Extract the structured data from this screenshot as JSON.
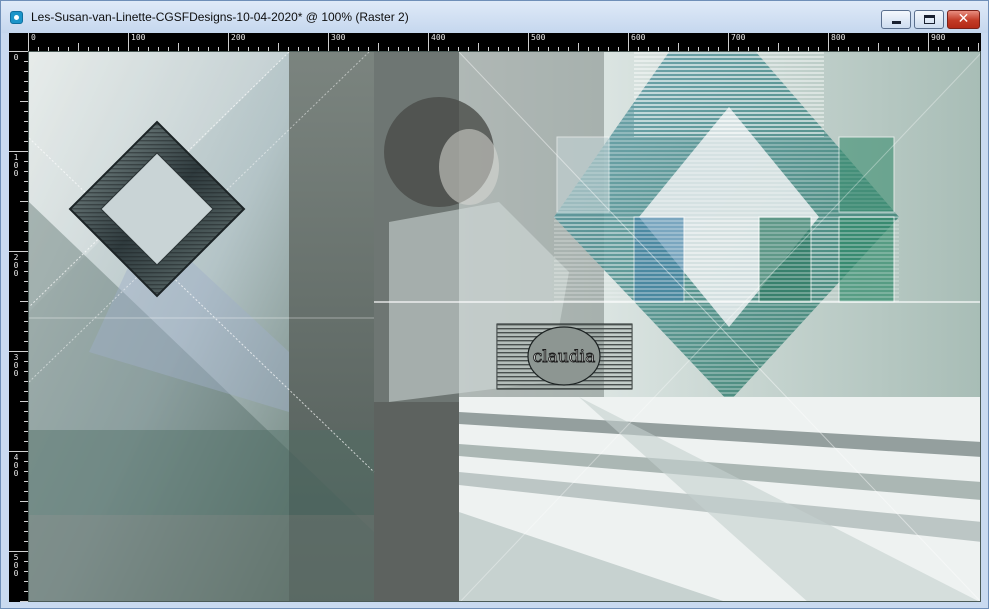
{
  "window": {
    "title": "Les-Susan-van-Linette-CGSFDesigns-10-04-2020* @ 100% (Raster 2)",
    "close_glyph": "✕"
  },
  "ruler": {
    "top_labels": [
      "0",
      "100",
      "200",
      "300",
      "400",
      "500",
      "600",
      "700",
      "800",
      "900"
    ],
    "left_labels": [
      "0",
      "100",
      "200",
      "300",
      "400",
      "500"
    ]
  },
  "canvas": {
    "watermark_text": "claudia",
    "icons": {
      "app": "paint-app-icon",
      "minimize": "minimize-icon",
      "maximize": "maximize-icon",
      "close": "close-icon"
    }
  },
  "colors": {
    "titlebar": "#c9daf0",
    "close_button": "#c23a26",
    "ruler_bg": "#000000",
    "art_teal": "#2f7a66",
    "art_slate": "#6f7d7a"
  }
}
